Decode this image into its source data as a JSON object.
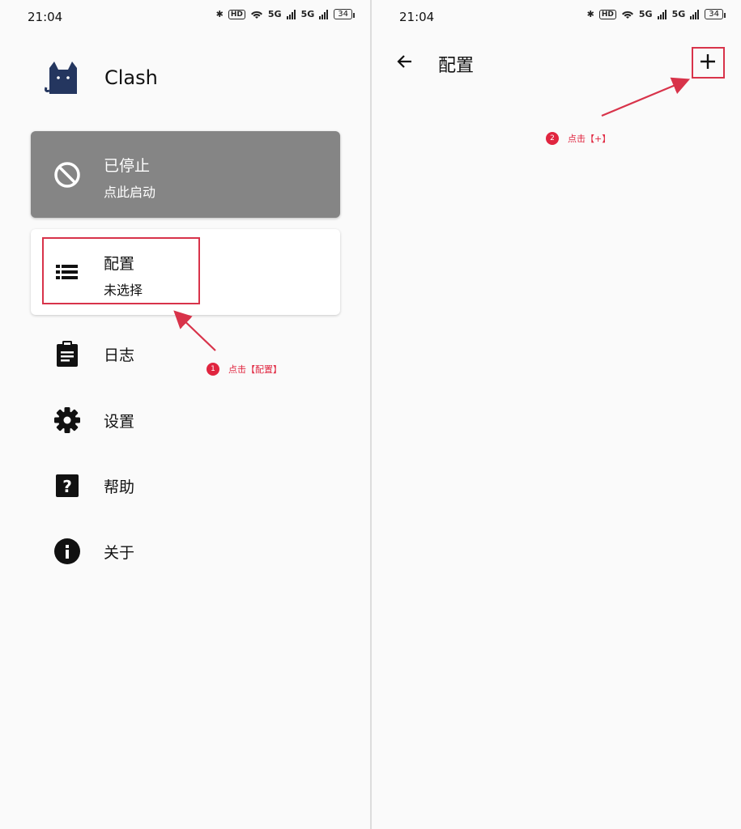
{
  "status_bar": {
    "time": "21:04",
    "network": "5G",
    "hd": "HD",
    "battery": "34"
  },
  "sidebar": {
    "app_name": "Clash",
    "service_card": {
      "title": "已停止",
      "subtitle": "点此启动"
    },
    "profile_card": {
      "title": "配置",
      "subtitle": "未选择"
    },
    "items": [
      {
        "label": "日志",
        "icon": "clipboard-icon"
      },
      {
        "label": "设置",
        "icon": "gear-icon"
      },
      {
        "label": "帮助",
        "icon": "help-icon"
      },
      {
        "label": "关于",
        "icon": "info-icon"
      }
    ]
  },
  "profiles_screen": {
    "title": "配置"
  },
  "annotations": {
    "step1": {
      "number": "1",
      "text": "点击【配置】"
    },
    "step2": {
      "number": "2",
      "text": "点击【+】"
    },
    "highlight_color": "#d8334a"
  }
}
